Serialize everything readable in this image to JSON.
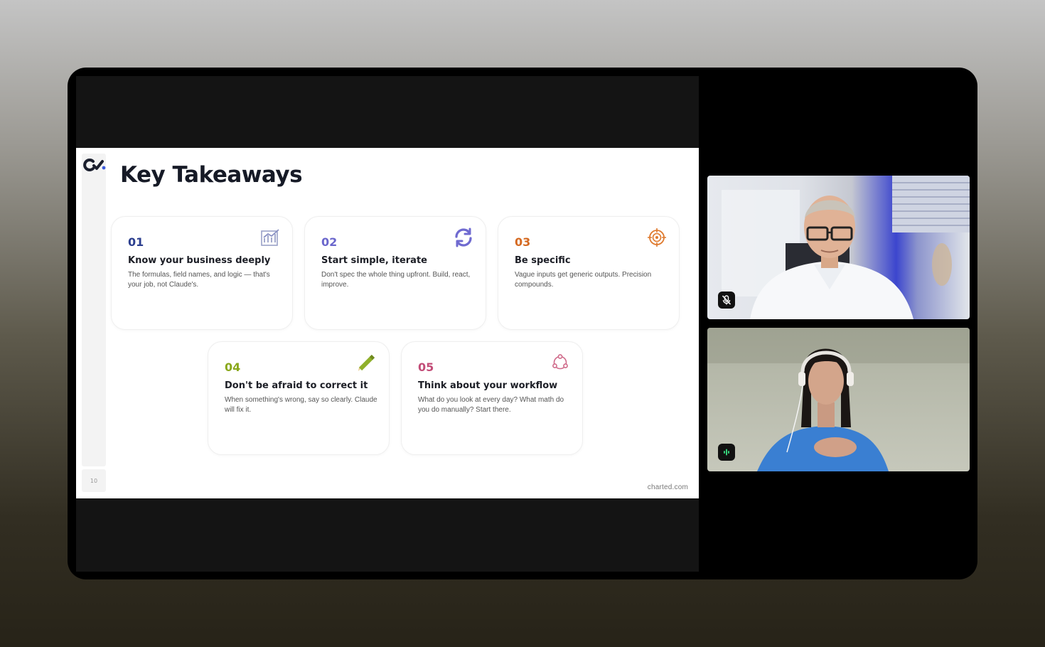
{
  "slide": {
    "title": "Key Takeaways",
    "page_number": "10",
    "footer_url": "charted.com",
    "cards": [
      {
        "num": "01",
        "title": "Know your business deeply",
        "desc": "The formulas, field names, and logic — that's your job, not Claude's.",
        "color": "#2c3f8f",
        "icon": "chart-icon"
      },
      {
        "num": "02",
        "title": "Start simple, iterate",
        "desc": "Don't spec the whole thing upfront. Build, react, improve.",
        "color": "#6b67cc",
        "icon": "refresh-icon"
      },
      {
        "num": "03",
        "title": "Be specific",
        "desc": "Vague inputs get generic outputs. Precision compounds.",
        "color": "#d56a22",
        "icon": "target-icon"
      },
      {
        "num": "04",
        "title": "Don't be afraid to correct it",
        "desc": "When something's wrong, say so clearly. Claude will fix it.",
        "color": "#8aa81c",
        "icon": "pencil-icon"
      },
      {
        "num": "05",
        "title": "Think about your workflow",
        "desc": "What do you look at every day? What math do you do manually? Start there.",
        "color": "#c24d78",
        "icon": "cycle-icon"
      }
    ]
  },
  "participants": [
    {
      "status": "muted",
      "icon": "mic-muted-icon"
    },
    {
      "status": "speaking",
      "icon": "speaking-indicator-icon"
    }
  ]
}
